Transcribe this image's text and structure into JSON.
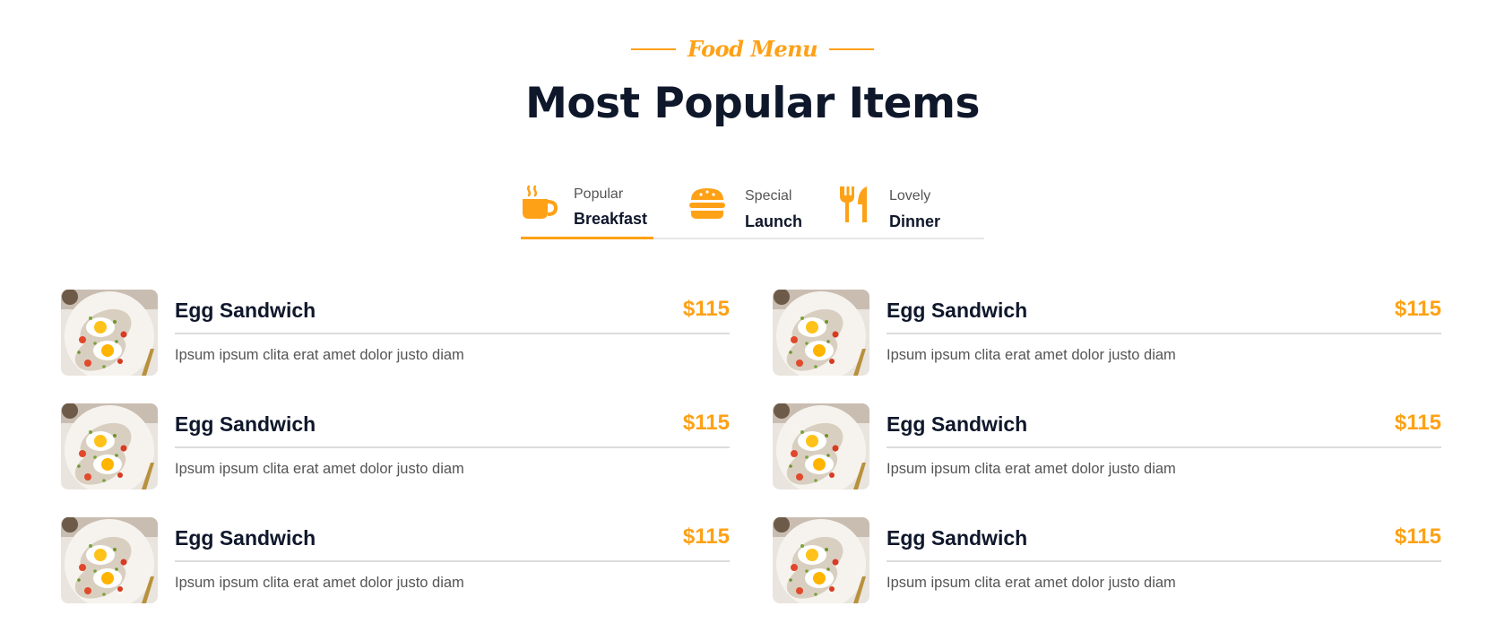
{
  "section": {
    "subtitle": "Food Menu",
    "title": "Most Popular Items"
  },
  "tabs": [
    {
      "small": "Popular",
      "big": "Breakfast",
      "icon": "coffee-icon",
      "active": true
    },
    {
      "small": "Special",
      "big": "Launch",
      "icon": "hamburger-icon",
      "active": false
    },
    {
      "small": "Lovely",
      "big": "Dinner",
      "icon": "utensils-icon",
      "active": false
    }
  ],
  "menu": {
    "items": [
      {
        "name": "Egg Sandwich",
        "price": "$115",
        "description": "Ipsum ipsum clita erat amet dolor justo diam"
      },
      {
        "name": "Egg Sandwich",
        "price": "$115",
        "description": "Ipsum ipsum clita erat amet dolor justo diam"
      },
      {
        "name": "Egg Sandwich",
        "price": "$115",
        "description": "Ipsum ipsum clita erat amet dolor justo diam"
      },
      {
        "name": "Egg Sandwich",
        "price": "$115",
        "description": "Ipsum ipsum clita erat amet dolor justo diam"
      },
      {
        "name": "Egg Sandwich",
        "price": "$115",
        "description": "Ipsum ipsum clita erat amet dolor justo diam"
      },
      {
        "name": "Egg Sandwich",
        "price": "$115",
        "description": "Ipsum ipsum clita erat amet dolor justo diam"
      }
    ]
  },
  "colors": {
    "accent": "#FEA116",
    "heading": "#0F172B",
    "body_text": "#555555"
  }
}
